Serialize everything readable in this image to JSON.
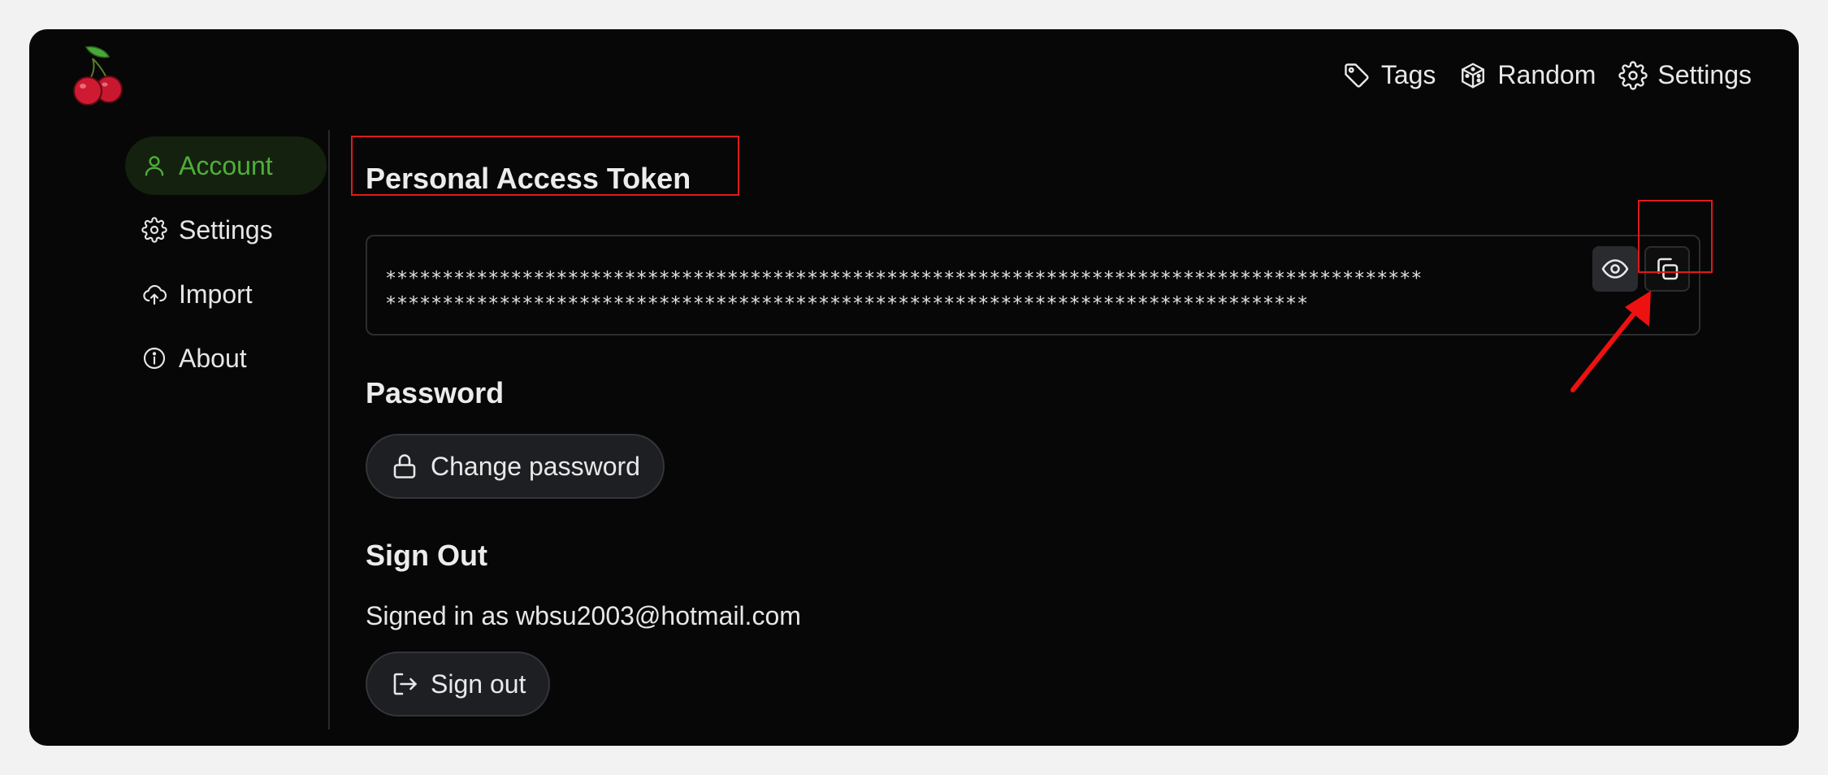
{
  "topnav": {
    "tags_label": "Tags",
    "random_label": "Random",
    "settings_label": "Settings"
  },
  "sidebar": {
    "items": [
      {
        "label": "Account",
        "icon": "user-icon",
        "active": true
      },
      {
        "label": "Settings",
        "icon": "gear-icon",
        "active": false
      },
      {
        "label": "Import",
        "icon": "cloud-upload-icon",
        "active": false
      },
      {
        "label": "About",
        "icon": "info-icon",
        "active": false
      }
    ]
  },
  "main": {
    "token_heading": "Personal Access Token",
    "token_value_line1": "*******************************************************************************************",
    "token_value_line2": "*********************************************************************************",
    "password_heading": "Password",
    "change_password_label": "Change password",
    "signout_heading": "Sign Out",
    "signed_in_text": "Signed in as wbsu2003@hotmail.com",
    "sign_out_label": "Sign out"
  },
  "colors": {
    "background": "#070707",
    "accent_green": "#4fae3a",
    "active_bg": "#15210f",
    "annotation_red": "#e01a1a"
  }
}
